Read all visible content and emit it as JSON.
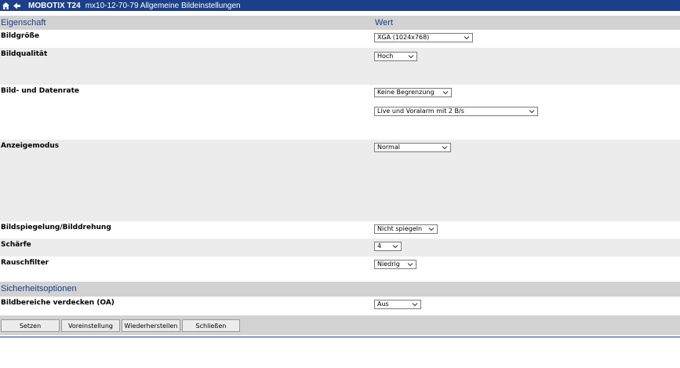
{
  "titlebar": {
    "brand": "MOBOTIX T24",
    "subtitle": "mx10-12-70-79 Allgemeine Bildeinstellungen",
    "home_icon": "home-icon",
    "back_icon": "back-arrow-icon"
  },
  "header": {
    "col_property": "Eigenschaft",
    "col_value": "Wert"
  },
  "rows": {
    "bildgroesse": {
      "label": "Bildgröße",
      "value": "XGA (1024x768)"
    },
    "bildqualitaet": {
      "label": "Bildqualität",
      "value": "Hoch"
    },
    "datenrate": {
      "label": "Bild- und Datenrate",
      "value": "Keine Begrenzung",
      "value2": "Live und Voralarm mit 2 B/s"
    },
    "anzeigemodus": {
      "label": "Anzeigemodus",
      "value": "Normal"
    },
    "spiegelung": {
      "label": "Bildspiegelung/Bilddrehung",
      "value": "Nicht spiegeln"
    },
    "schaerfe": {
      "label": "Schärfe",
      "value": "4"
    },
    "rauschfilter": {
      "label": "Rauschfilter",
      "value": "Niedrig"
    }
  },
  "section2": {
    "title": "Sicherheitsoptionen"
  },
  "oa": {
    "label": "Bildbereiche verdecken (OA)",
    "value": "Aus"
  },
  "buttons": {
    "set": "Setzen",
    "default": "Voreinstellung",
    "restore": "Wiederherstellen",
    "close": "Schließen"
  },
  "colors": {
    "accent": "#1c3f8a",
    "header_bg": "#d2d2d2",
    "row_gray": "#ececec"
  }
}
